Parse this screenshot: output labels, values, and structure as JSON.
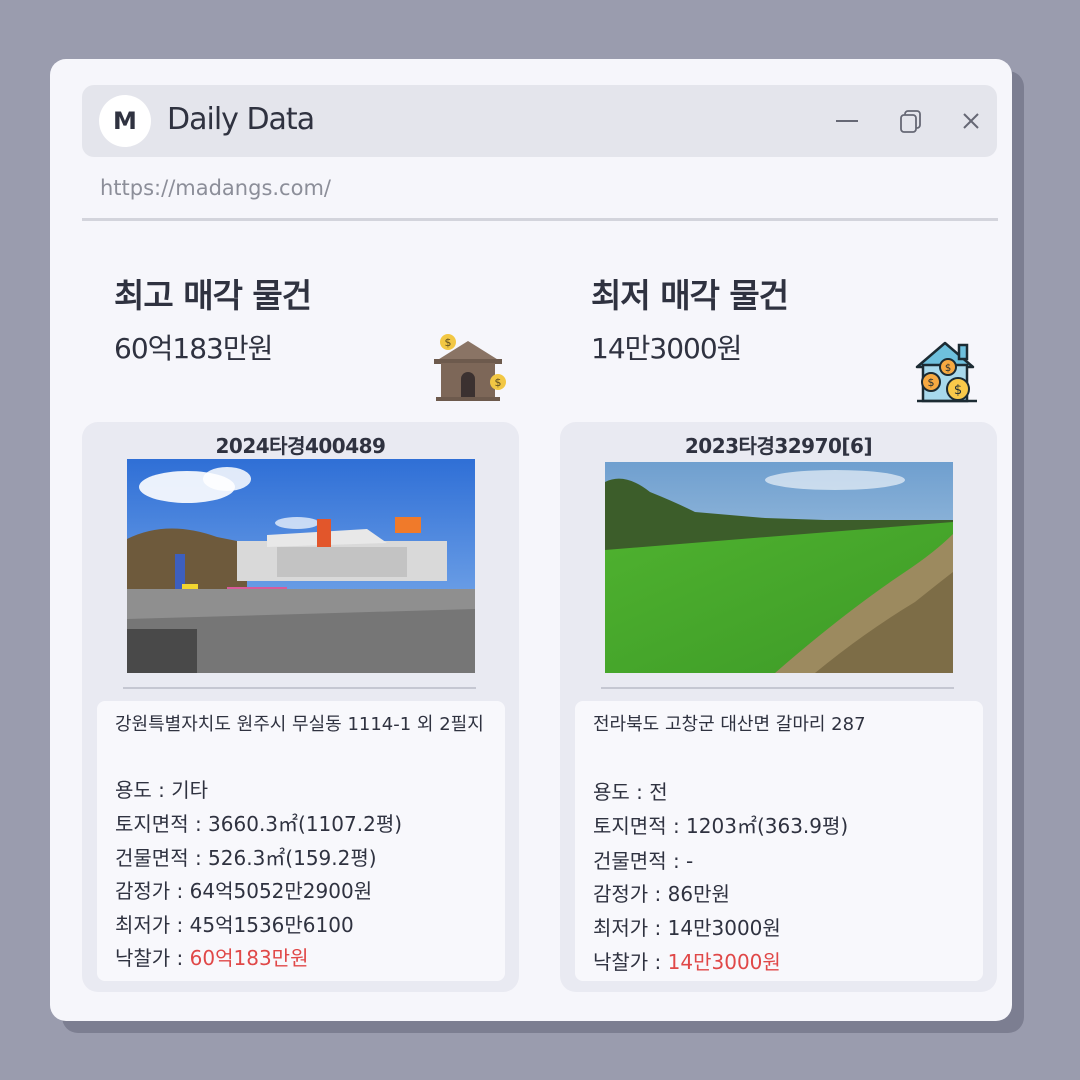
{
  "window": {
    "logo_letter": "M",
    "title": "Daily Data",
    "url": "https://madangs.com/"
  },
  "icons": [
    "minimize-icon",
    "copy-icon",
    "close-icon",
    "house-money-icon",
    "house-coins-icon"
  ],
  "colors": {
    "background": "#9a9cae",
    "window": "#f6f6fb",
    "card": "#e9eaf2",
    "highlight": "#e04848",
    "text": "#2f3240"
  },
  "highest": {
    "heading": "최고 매각 물건",
    "amount": "60억183만원",
    "case_no": "2024타경400489",
    "address": "강원특별자치도 원주시 무실동 1114-1 외 2필지",
    "usage": "용도 : 기타",
    "land_area": "토지면적 : 3660.3㎡(1107.2평)",
    "building_area": "건물면적 : 526.3㎡(159.2평)",
    "appraisal": "감정가 : 64억5052만2900원",
    "min_price": "최저가 : 45억1536만6100",
    "winning_label": "낙찰가 : ",
    "winning_value": "60억183만원"
  },
  "lowest": {
    "heading": "최저 매각 물건",
    "amount": "14만3000원",
    "case_no": "2023타경32970[6]",
    "address": "전라북도 고창군 대산면 갈마리 287",
    "usage": "용도 : 전",
    "land_area": "토지면적 : 1203㎡(363.9평)",
    "building_area": "건물면적 : -",
    "appraisal": "감정가 : 86만원",
    "min_price": "최저가 : 14만3000원",
    "winning_label": "낙찰가 : ",
    "winning_value": "14만3000원"
  }
}
